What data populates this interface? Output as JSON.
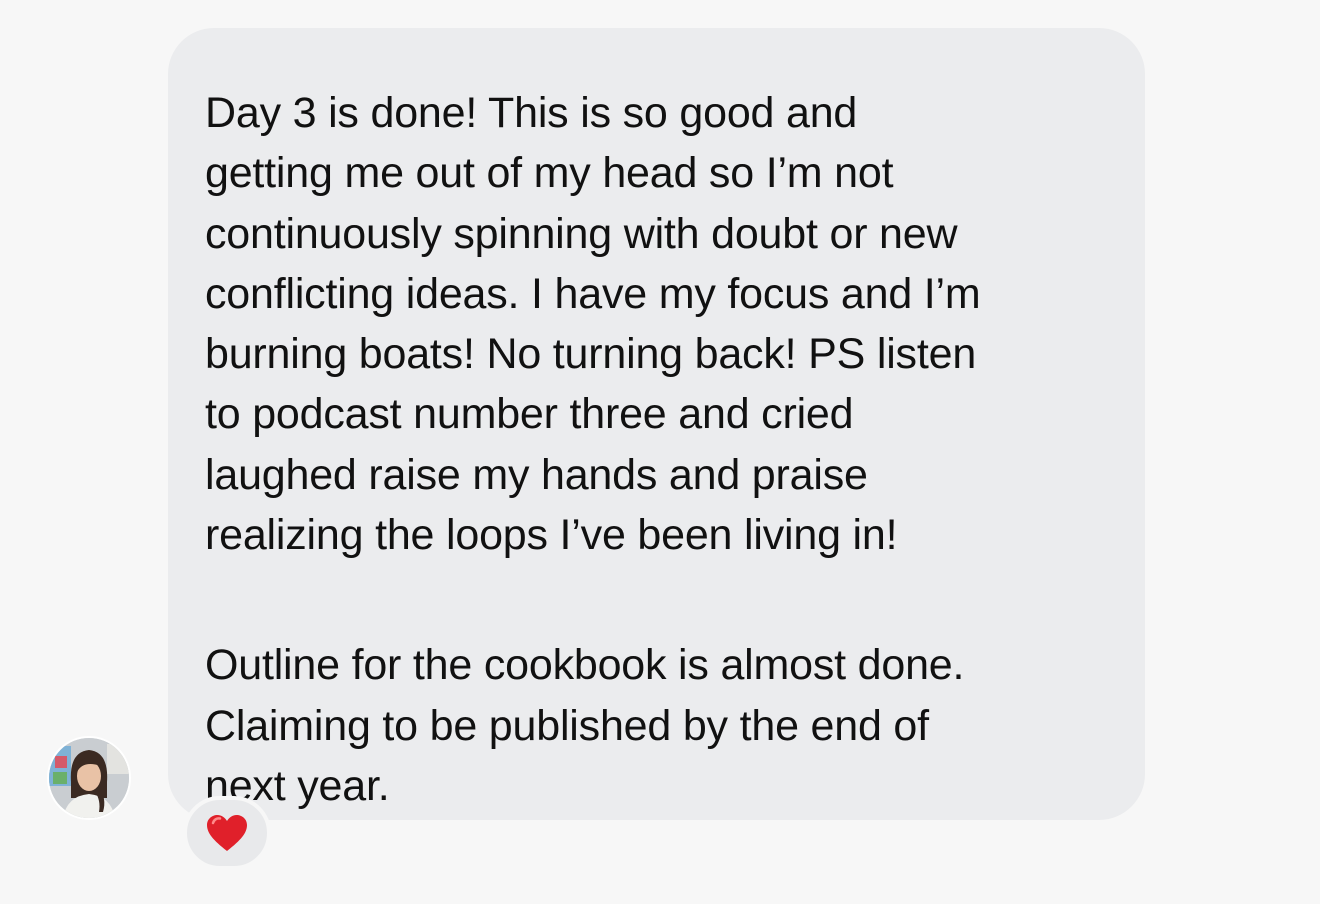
{
  "message": {
    "paragraph1": [
      "Day 3 is done! This is so good and",
      "getting me out of my head so I’m not",
      "continuously spinning with doubt or new",
      "conflicting ideas. I have my focus and I’m",
      "burning boats! No turning back! PS listen",
      "to podcast number three and cried",
      "laughed raise my hands and praise",
      "realizing the loops I’ve been living in!"
    ],
    "paragraph2": [
      "Outline for the cookbook is almost done.",
      "Claiming to be published by the end of",
      "next year."
    ]
  },
  "reaction": {
    "icon": "red-heart-icon",
    "color": "#e0202a"
  },
  "avatar": {
    "icon": "user-avatar-photo"
  },
  "colors": {
    "background": "#f7f7f7",
    "bubble": "#ebecee",
    "text": "#111111"
  }
}
